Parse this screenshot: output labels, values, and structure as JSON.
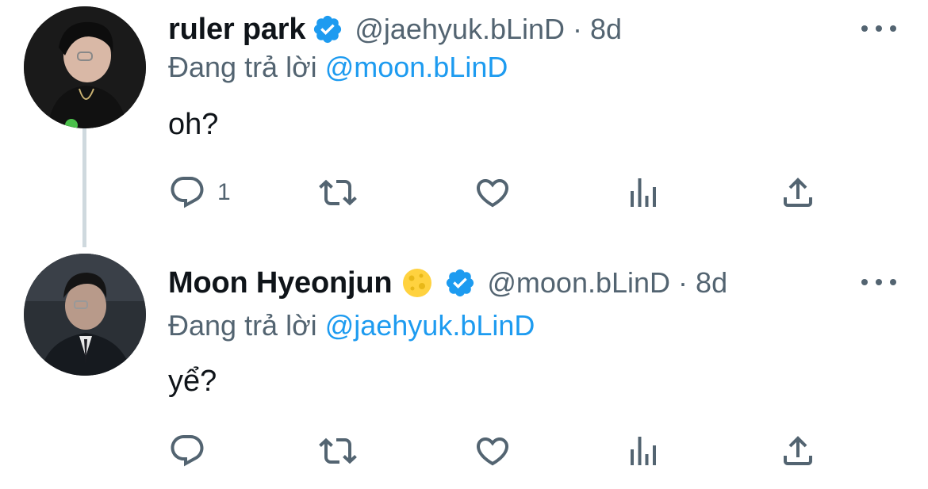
{
  "tweets": [
    {
      "display_name": "ruler park",
      "handle": "@jaehyuk.bLinD",
      "separator": "·",
      "time": "8d",
      "reply_prefix": "Đang trả lời",
      "reply_to": "@moon.bLinD",
      "text": "oh?",
      "reply_count": "1",
      "verified": true,
      "emoji": ""
    },
    {
      "display_name": "Moon Hyeonjun",
      "handle": "@moon.bLinD",
      "separator": "·",
      "time": "8d",
      "reply_prefix": "Đang trả lời",
      "reply_to": "@jaehyuk.bLinD",
      "text": "yể?",
      "reply_count": "",
      "verified": true,
      "emoji": "moon-emoji"
    }
  ],
  "icons": {
    "reply": "reply-icon",
    "retweet": "retweet-icon",
    "like": "heart-icon",
    "views": "views-icon",
    "share": "share-icon",
    "more": "more-icon",
    "verified": "verified-badge-icon"
  },
  "colors": {
    "accent": "#1d9bf0",
    "secondary_text": "#536471",
    "primary_text": "#0f1419",
    "thread_line": "#cfd9de"
  }
}
